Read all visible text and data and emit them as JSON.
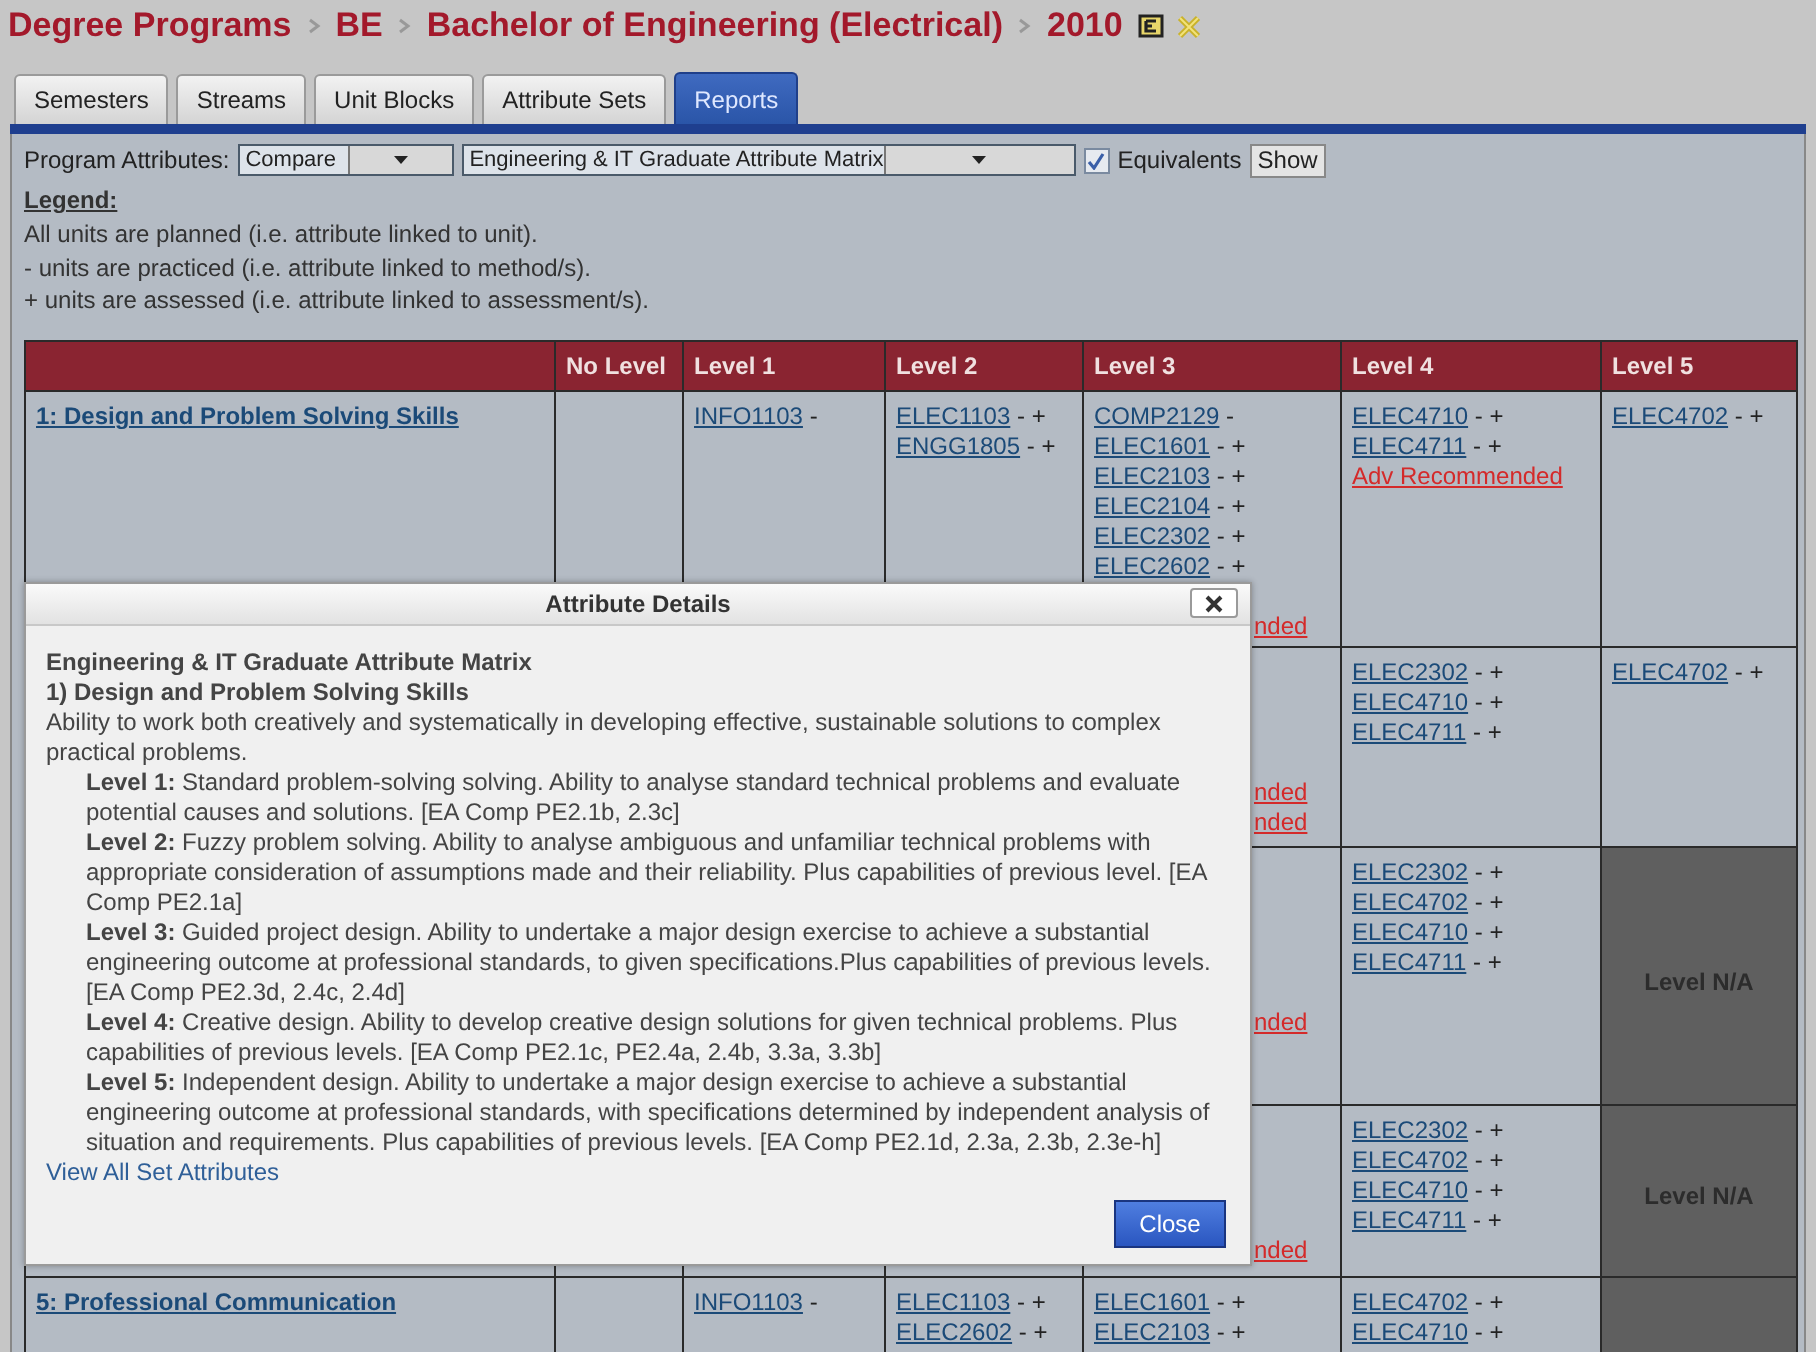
{
  "breadcrumb": [
    "Degree Programs",
    "BE",
    "Bachelor of Engineering (Electrical)",
    "2010"
  ],
  "tabs": [
    {
      "label": "Semesters",
      "selected": false
    },
    {
      "label": "Streams",
      "selected": false
    },
    {
      "label": "Unit Blocks",
      "selected": false
    },
    {
      "label": "Attribute Sets",
      "selected": false
    },
    {
      "label": "Reports",
      "selected": true
    }
  ],
  "filter": {
    "label": "Program Attributes:",
    "mode": "Compare",
    "matrix": "Engineering & IT Graduate Attribute Matrix",
    "equivalents": {
      "label": "Equivalents",
      "checked": true
    },
    "button": "Show"
  },
  "legend": {
    "title": "Legend:",
    "lines": [
      "All units are planned (i.e. attribute linked to unit).",
      "- units are practiced (i.e. attribute linked to method/s).",
      "+ units are assessed (i.e. attribute linked to assessment/s)."
    ]
  },
  "table": {
    "columns": [
      "",
      "No Level",
      "Level 1",
      "Level 2",
      "Level 3",
      "Level 4",
      "Level 5"
    ],
    "rows": [
      {
        "cells": [
          {
            "kind": "title",
            "text": "1: Design and Problem Solving Skills"
          },
          {
            "kind": "blank"
          },
          {
            "kind": "units",
            "items": [
              {
                "kind": "unit",
                "code": "INFO1103",
                "marks": "-"
              }
            ]
          },
          {
            "kind": "units",
            "items": [
              {
                "kind": "unit",
                "code": "ELEC1103",
                "marks": "- +"
              },
              {
                "kind": "unit",
                "code": "ENGG1805",
                "marks": "- +"
              }
            ]
          },
          {
            "kind": "units",
            "items": [
              {
                "kind": "unit",
                "code": "COMP2129",
                "marks": "-"
              },
              {
                "kind": "unit",
                "code": "ELEC1601",
                "marks": "- +"
              },
              {
                "kind": "unit",
                "code": "ELEC2103",
                "marks": "- +"
              },
              {
                "kind": "unit",
                "code": "ELEC2104",
                "marks": "- +"
              },
              {
                "kind": "unit",
                "code": "ELEC2302",
                "marks": "- +"
              },
              {
                "kind": "unit",
                "code": "ELEC2602",
                "marks": "- +"
              },
              {
                "kind": "covered"
              },
              {
                "kind": "advice_cut",
                "text": "nded"
              }
            ]
          },
          {
            "kind": "units",
            "items": [
              {
                "kind": "unit",
                "code": "ELEC4710",
                "marks": "- +"
              },
              {
                "kind": "unit",
                "code": "ELEC4711",
                "marks": "- +"
              },
              {
                "kind": "advice",
                "text": "Adv Recommended"
              }
            ]
          },
          {
            "kind": "units",
            "items": [
              {
                "kind": "unit",
                "code": "ELEC4702",
                "marks": "- +"
              }
            ]
          }
        ]
      },
      {
        "cells": [
          {
            "kind": "blank"
          },
          {
            "kind": "blank"
          },
          {
            "kind": "blank"
          },
          {
            "kind": "blank"
          },
          {
            "kind": "units",
            "items": [
              {
                "kind": "covered"
              },
              {
                "kind": "covered"
              },
              {
                "kind": "covered"
              },
              {
                "kind": "covered"
              },
              {
                "kind": "advice_cut",
                "text": "nded"
              },
              {
                "kind": "advice_cut",
                "text": "nded"
              }
            ]
          },
          {
            "kind": "units",
            "items": [
              {
                "kind": "unit",
                "code": "ELEC2302",
                "marks": "- +"
              },
              {
                "kind": "unit",
                "code": "ELEC4710",
                "marks": "- +"
              },
              {
                "kind": "unit",
                "code": "ELEC4711",
                "marks": "- +"
              }
            ]
          },
          {
            "kind": "units",
            "items": [
              {
                "kind": "unit",
                "code": "ELEC4702",
                "marks": "- +"
              }
            ]
          }
        ]
      },
      {
        "cells": [
          {
            "kind": "blank"
          },
          {
            "kind": "blank"
          },
          {
            "kind": "blank"
          },
          {
            "kind": "blank"
          },
          {
            "kind": "units",
            "items": [
              {
                "kind": "covered"
              },
              {
                "kind": "covered"
              },
              {
                "kind": "covered"
              },
              {
                "kind": "covered"
              },
              {
                "kind": "covered"
              },
              {
                "kind": "advice_cut",
                "text": "nded"
              }
            ]
          },
          {
            "kind": "units",
            "items": [
              {
                "kind": "unit",
                "code": "ELEC2302",
                "marks": "- +"
              },
              {
                "kind": "unit",
                "code": "ELEC4702",
                "marks": "- +"
              },
              {
                "kind": "unit",
                "code": "ELEC4710",
                "marks": "- +"
              },
              {
                "kind": "unit",
                "code": "ELEC4711",
                "marks": "- +"
              }
            ]
          },
          {
            "kind": "na",
            "label": "Level N/A"
          }
        ]
      },
      {
        "cells": [
          {
            "kind": "blank"
          },
          {
            "kind": "blank"
          },
          {
            "kind": "blank"
          },
          {
            "kind": "blank"
          },
          {
            "kind": "units",
            "items": [
              {
                "kind": "covered"
              },
              {
                "kind": "covered"
              },
              {
                "kind": "covered"
              },
              {
                "kind": "covered"
              },
              {
                "kind": "advice_cut",
                "text": "nded"
              }
            ]
          },
          {
            "kind": "units",
            "items": [
              {
                "kind": "unit",
                "code": "ELEC2302",
                "marks": "- +"
              },
              {
                "kind": "unit",
                "code": "ELEC4702",
                "marks": "- +"
              },
              {
                "kind": "unit",
                "code": "ELEC4710",
                "marks": "- +"
              },
              {
                "kind": "unit",
                "code": "ELEC4711",
                "marks": "- +"
              }
            ]
          },
          {
            "kind": "na",
            "label": "Level N/A"
          }
        ]
      },
      {
        "cells": [
          {
            "kind": "title",
            "text": "5: Professional Communication"
          },
          {
            "kind": "blank"
          },
          {
            "kind": "units",
            "items": [
              {
                "kind": "unit",
                "code": "INFO1103",
                "marks": "-"
              }
            ]
          },
          {
            "kind": "units",
            "items": [
              {
                "kind": "unit",
                "code": "ELEC1103",
                "marks": "- +"
              },
              {
                "kind": "unit",
                "code": "ELEC2602",
                "marks": "- +"
              }
            ]
          },
          {
            "kind": "units",
            "items": [
              {
                "kind": "unit",
                "code": "ELEC1601",
                "marks": "- +"
              },
              {
                "kind": "unit",
                "code": "ELEC2103",
                "marks": "- +"
              }
            ]
          },
          {
            "kind": "units",
            "items": [
              {
                "kind": "unit",
                "code": "ELEC4702",
                "marks": "- +"
              },
              {
                "kind": "unit",
                "code": "ELEC4710",
                "marks": "- +"
              }
            ]
          },
          {
            "kind": "na"
          }
        ]
      }
    ]
  },
  "dialog": {
    "title": "Attribute Details",
    "heading": "Engineering & IT Graduate Attribute Matrix",
    "subheading": "1) Design and Problem Solving Skills",
    "description": "Ability to work both creatively and systematically in developing effective, sustainable solutions to complex practical problems.",
    "levels": [
      "**Level 1:** Standard problem-solving solving. Ability to analyse standard technical problems and evaluate potential causes and solutions. [EA Comp PE2.1b, 2.3c]",
      "**Level 2:** Fuzzy problem solving. Ability to analyse ambiguous and unfamiliar technical problems with appropriate consideration of assumptions made and their reliability. Plus capabilities of previous level. [EA Comp PE2.1a]",
      "**Level 3:** Guided project design. Ability to undertake a major design exercise to achieve a substantial engineering outcome at professional standards, to given specifications.Plus capabilities of previous levels. [EA Comp PE2.3d, 2.4c, 2.4d]",
      "**Level 4:** Creative design. Ability to develop creative design solutions for given technical problems. Plus capabilities of previous levels. [EA Comp PE2.1c, PE2.4a, 2.4b, 3.3a, 3.3b]",
      "**Level 5:** Independent design. Ability to undertake a major design exercise to achieve a substantial engineering outcome at professional standards, with specifications determined by independent analysis of situation and requirements. Plus capabilities of previous levels. [EA Comp PE2.1d, 2.3a, 2.3b, 2.3e-h]"
    ],
    "link": "View All Set Attributes",
    "button": "Close"
  }
}
